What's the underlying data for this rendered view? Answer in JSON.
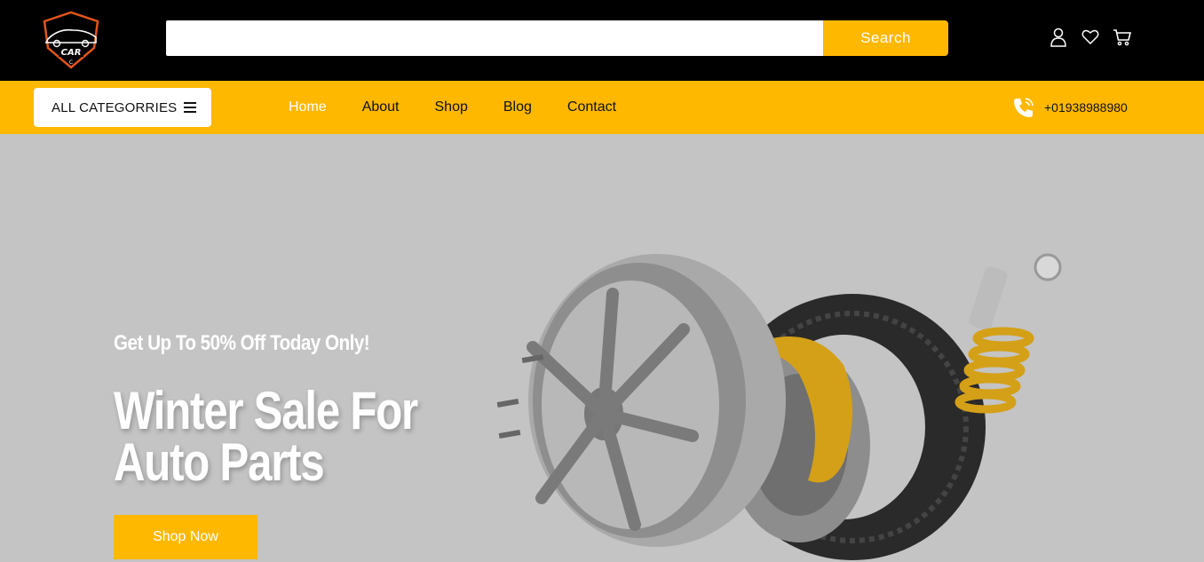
{
  "header": {
    "logo_text": "CAR",
    "search": {
      "value": "",
      "placeholder": "",
      "button_label": "Search"
    },
    "icons": [
      "user-icon",
      "heart-icon",
      "cart-icon"
    ]
  },
  "nav": {
    "categories_label": "ALL CATEGORRIES",
    "links": [
      {
        "label": "Home",
        "active": true
      },
      {
        "label": "About",
        "active": false
      },
      {
        "label": "Shop",
        "active": false
      },
      {
        "label": "Blog",
        "active": false
      },
      {
        "label": "Contact",
        "active": false
      }
    ],
    "phone": "+01938988980"
  },
  "hero": {
    "subtitle": "Get Up To 50% Off Today Only!",
    "title_line1": "Winter Sale For",
    "title_line2": "Auto Parts",
    "cta_label": "Shop Now"
  },
  "colors": {
    "accent": "#ffb800",
    "header_bg": "#000000",
    "hero_bg": "#c4c4c4"
  }
}
